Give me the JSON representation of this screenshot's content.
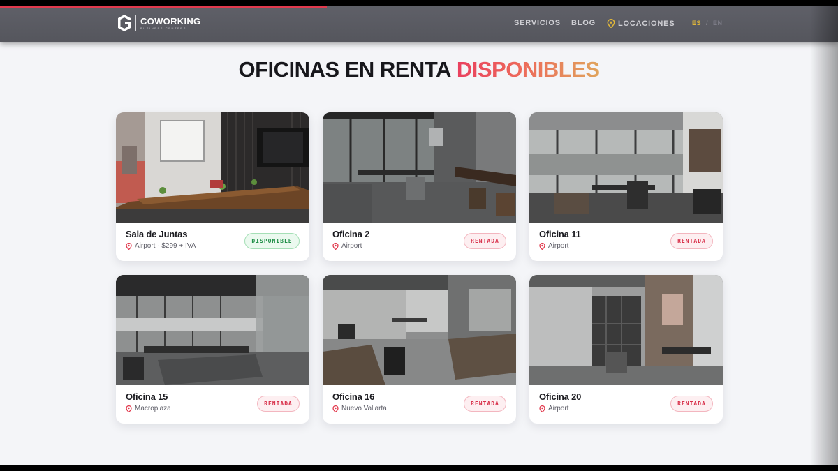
{
  "brand": {
    "logo_title": "COWORKING",
    "logo_subtitle": "BUSINESS CENTERS"
  },
  "nav": {
    "services": "SERVICIOS",
    "blog": "BLOG",
    "locations": "LOCACIONES",
    "lang_es": "ES",
    "lang_separator": "/",
    "lang_en": "EN"
  },
  "headline": {
    "part1": "OFICINAS EN RENTA",
    "part2": "DISPONIBLES"
  },
  "colors": {
    "available": "#23904a",
    "rented": "#d8304a",
    "accent_yellow": "#e0b73a"
  },
  "offices": [
    {
      "name": "Sala de Juntas",
      "location": "Airport · $299 + IVA",
      "status": "DISPONIBLE"
    },
    {
      "name": "Oficina 2",
      "location": "Airport",
      "status": "RENTADA"
    },
    {
      "name": "Oficina 11",
      "location": "Airport",
      "status": "RENTADA"
    },
    {
      "name": "Oficina 15",
      "location": "Macroplaza",
      "status": "RENTADA"
    },
    {
      "name": "Oficina 16",
      "location": "Nuevo Vallarta",
      "status": "RENTADA"
    },
    {
      "name": "Oficina 20",
      "location": "Airport",
      "status": "RENTADA"
    }
  ]
}
